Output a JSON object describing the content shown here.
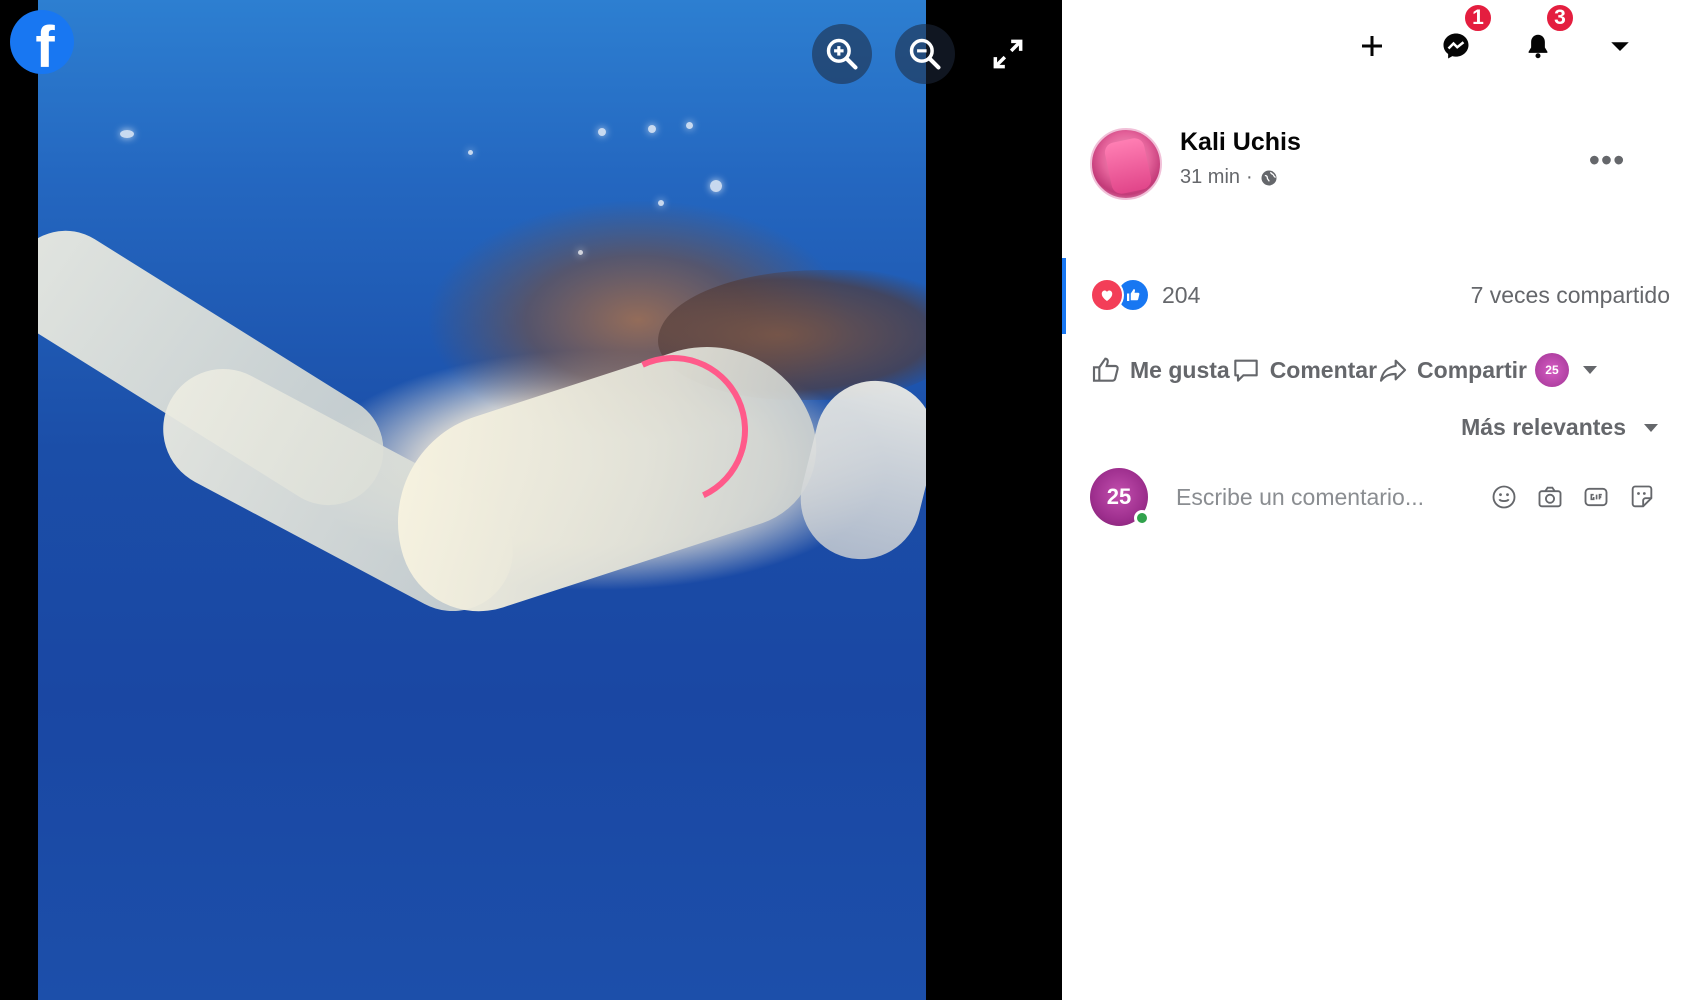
{
  "viewer": {
    "logo_letter": "f",
    "controls": [
      "zoom-in",
      "zoom-out",
      "fullscreen"
    ]
  },
  "topbar": {
    "messenger_badge": "1",
    "notifications_badge": "3"
  },
  "post": {
    "author": "Kali Uchis",
    "time": "31 min",
    "separator": "·",
    "reaction_count": "204",
    "shares": "7 veces compartido"
  },
  "actions": {
    "like": "Me gusta",
    "comment": "Comentar",
    "share": "Compartir",
    "share_avatar_text": "25"
  },
  "comments": {
    "sort_label": "Más relevantes",
    "placeholder": "Escribe un comentario...",
    "avatar_text": "25"
  },
  "colors": {
    "brand": "#1877f2",
    "badge": "#e41e3f",
    "love": "#f33e58",
    "online": "#31a24c",
    "muted_text": "#65676b"
  }
}
